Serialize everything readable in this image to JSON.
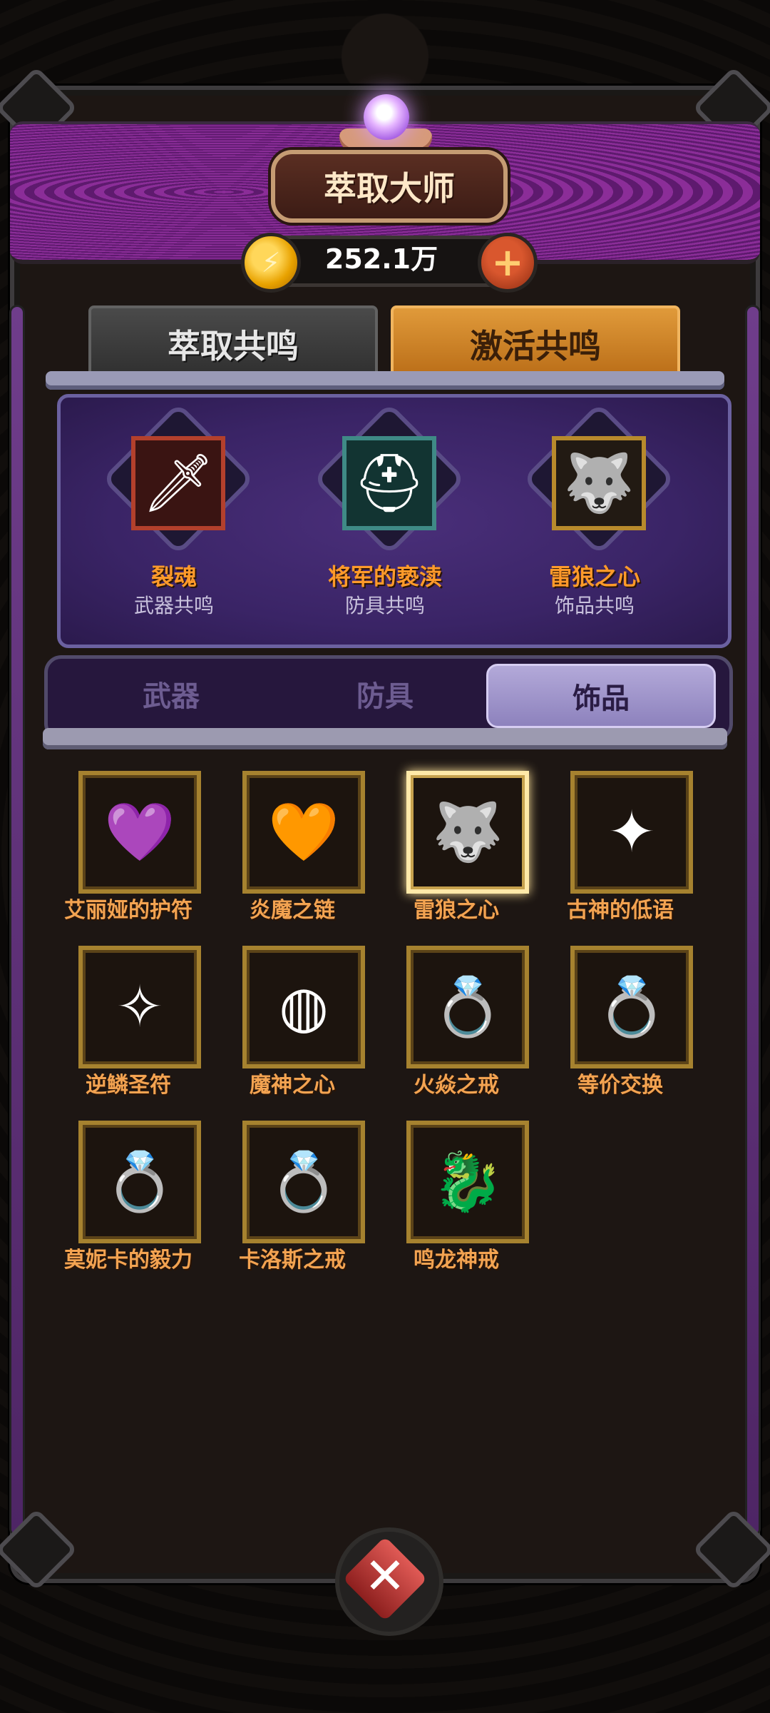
{
  "header": {
    "title": "萃取大师",
    "currency_value": "252.1万"
  },
  "main_tabs": [
    {
      "label": "萃取共鸣",
      "active": false
    },
    {
      "label": "激活共鸣",
      "active": true
    }
  ],
  "resonance": [
    {
      "name": "裂魂",
      "type": "武器共鸣",
      "icon": "sword-icon",
      "glyph": "🗡"
    },
    {
      "name": "将军的亵渎",
      "type": "防具共鸣",
      "icon": "helmet-icon",
      "glyph": "⛑"
    },
    {
      "name": "雷狼之心",
      "type": "饰品共鸣",
      "icon": "wolf-amulet-icon",
      "glyph": "🐺"
    }
  ],
  "sub_tabs": [
    {
      "label": "武器",
      "active": false
    },
    {
      "label": "防具",
      "active": false
    },
    {
      "label": "饰品",
      "active": true
    }
  ],
  "items": [
    {
      "name": "艾丽娅的护符",
      "icon": "purple-gem-amulet-icon",
      "glyph": "💜"
    },
    {
      "name": "炎魔之链",
      "icon": "orange-gem-necklace-icon",
      "glyph": "🧡"
    },
    {
      "name": "雷狼之心",
      "icon": "wolf-amulet-icon",
      "glyph": "🐺",
      "selected": true
    },
    {
      "name": "古神的低语",
      "icon": "winged-gem-icon",
      "glyph": "✦"
    },
    {
      "name": "逆鳞圣符",
      "icon": "scale-amulet-icon",
      "glyph": "✧"
    },
    {
      "name": "魔神之心",
      "icon": "silver-collar-icon",
      "glyph": "◍"
    },
    {
      "name": "火焱之戒",
      "icon": "fire-ring-icon",
      "glyph": "💍"
    },
    {
      "name": "等价交换",
      "icon": "gold-ring-icon",
      "glyph": "💍"
    },
    {
      "name": "莫妮卡的毅力",
      "icon": "silver-ring-icon",
      "glyph": "💍"
    },
    {
      "name": "卡洛斯之戒",
      "icon": "bronze-ring-icon",
      "glyph": "💍"
    },
    {
      "name": "鸣龙神戒",
      "icon": "dragon-ring-icon",
      "glyph": "🐉"
    }
  ],
  "colors": {
    "accent_orange": "#f3a351",
    "active_tab": "#e09a3a",
    "panel_purple": "#3a2466"
  }
}
